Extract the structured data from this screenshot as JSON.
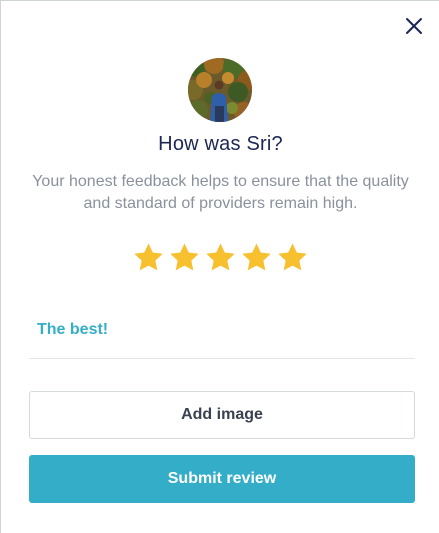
{
  "dialog": {
    "close_icon": "close-icon",
    "avatar_icon": "provider-avatar",
    "title": "How was Sri?",
    "subtitle": "Your honest feedback helps to ensure that the quality and standard of providers remain high.",
    "rating": 5,
    "max_rating": 5,
    "star_color": "#f7c02f",
    "review_text": "The best!",
    "add_image_label": "Add image",
    "submit_label": "Submit review",
    "accent_color": "#33adc8",
    "title_color": "#1d2753"
  }
}
